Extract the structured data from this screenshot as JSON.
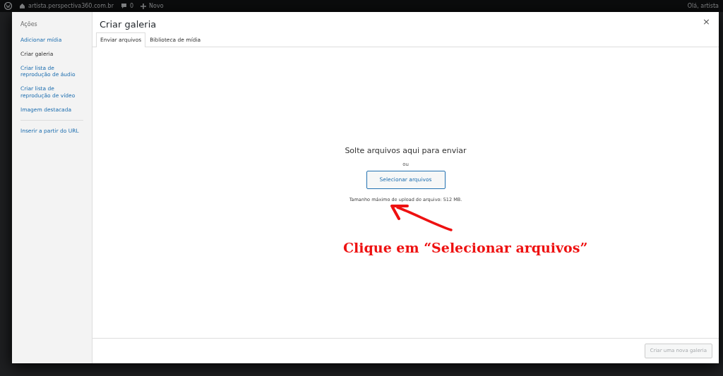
{
  "admin_bar": {
    "site": "artista.perspectiva360.com.br",
    "comments": "0",
    "new": "Novo",
    "greeting": "Olá, artista"
  },
  "modal": {
    "sidebar": {
      "heading": "Ações",
      "items": [
        {
          "label": "Adicionar mídia",
          "selected": false
        },
        {
          "label": "Criar galeria",
          "selected": true
        },
        {
          "label": "Criar lista de reprodução de áudio",
          "selected": false
        },
        {
          "label": "Criar lista de reprodução de vídeo",
          "selected": false
        },
        {
          "label": "Imagem destacada",
          "selected": false
        },
        {
          "label": "Inserir a partir do URL",
          "selected": false,
          "separated": true
        }
      ]
    },
    "title": "Criar galeria",
    "close": "×",
    "tabs": [
      {
        "label": "Enviar arquivos",
        "selected": true
      },
      {
        "label": "Biblioteca de mídia",
        "selected": false
      }
    ],
    "uploader": {
      "instructions": "Solte arquivos aqui para enviar",
      "or": "ou",
      "button": "Selecionar arquivos",
      "max_size": "Tamanho máximo de upload de arquivo: 512 MB."
    },
    "footer": {
      "button": {
        "label": "Criar uma nova galeria",
        "disabled": true
      }
    }
  },
  "annotation": {
    "text": "Clique em “Selecionar arquivos”"
  }
}
